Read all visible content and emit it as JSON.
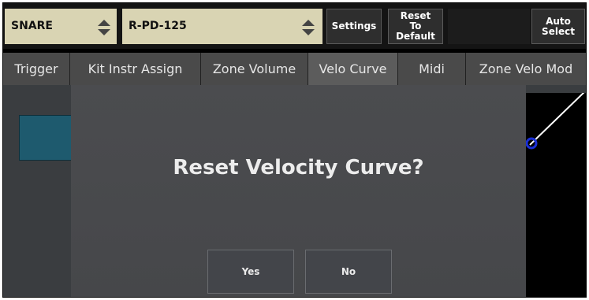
{
  "toolbar": {
    "pad_selector": {
      "value": "SNARE"
    },
    "model_selector": {
      "value": "R-PD-125"
    },
    "settings_label": "Settings",
    "reset_label": "Reset\nTo\nDefault",
    "auto_select_label": "Auto\nSelect"
  },
  "tabs": [
    {
      "label": "Trigger",
      "active": false
    },
    {
      "label": "Kit Instr Assign",
      "active": false
    },
    {
      "label": "Zone Volume",
      "active": false
    },
    {
      "label": "Velo Curve",
      "active": true
    },
    {
      "label": "Midi",
      "active": false
    },
    {
      "label": "Zone Velo Mod",
      "active": false
    }
  ],
  "dialog": {
    "title": "Reset Velocity Curve?",
    "yes_label": "Yes",
    "no_label": "No"
  },
  "colors": {
    "selector_bg": "#d9d4b3",
    "curve_line": "#ffffff",
    "curve_point": "#1a2fd6"
  }
}
